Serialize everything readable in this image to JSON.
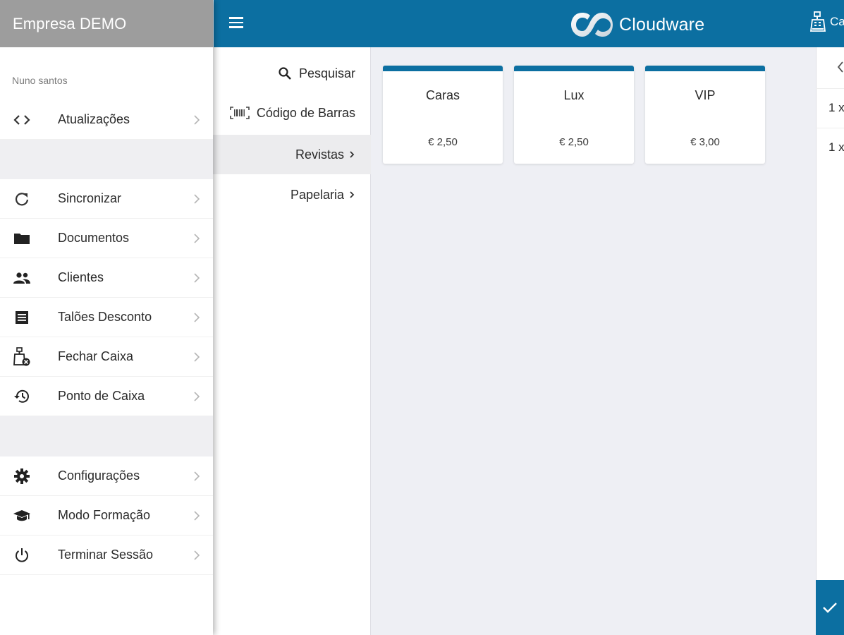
{
  "header": {
    "menu_icon": "hamburger-icon",
    "logo_text": "Cloudware",
    "register_label": "Ca",
    "register_icon": "cash-register-icon",
    "accent_color": "#0c6fa1"
  },
  "sidebar": {
    "company": "Empresa DEMO",
    "user": "Nuno santos",
    "items": [
      {
        "label": "Atualizações",
        "icon": "code-icon"
      },
      {
        "label": "Sincronizar",
        "icon": "refresh-icon"
      },
      {
        "label": "Documentos",
        "icon": "folder-icon"
      },
      {
        "label": "Clientes",
        "icon": "people-icon"
      },
      {
        "label": "Talões Desconto",
        "icon": "list-icon"
      },
      {
        "label": "Fechar Caixa",
        "icon": "register-close-icon"
      },
      {
        "label": "Ponto de Caixa",
        "icon": "history-icon"
      },
      {
        "label": "Configurações",
        "icon": "gear-icon"
      },
      {
        "label": "Modo Formação",
        "icon": "graduation-cap-icon"
      },
      {
        "label": "Terminar Sessão",
        "icon": "power-icon"
      }
    ]
  },
  "categories": [
    {
      "label": "Pesquisar",
      "icon": "search-icon"
    },
    {
      "label": "Código de Barras",
      "icon": "barcode-icon"
    },
    {
      "label": "Revistas",
      "active": true
    },
    {
      "label": "Papelaria"
    }
  ],
  "products": [
    {
      "name": "Caras",
      "price": "€ 2,50"
    },
    {
      "name": "Lux",
      "price": "€ 2,50"
    },
    {
      "name": "VIP",
      "price": "€ 3,00"
    }
  ],
  "cart": {
    "lines": [
      "1 x",
      "1 x"
    ],
    "confirm_icon": "check-icon"
  }
}
